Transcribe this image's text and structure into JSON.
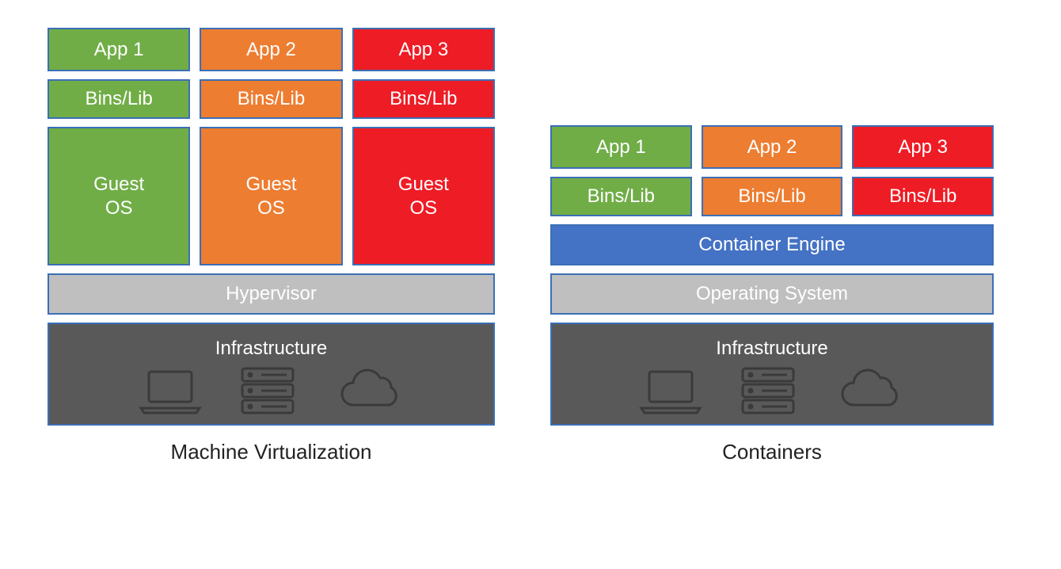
{
  "colors": {
    "green": "#70ad47",
    "orange": "#ed7d31",
    "red": "#ee1c25",
    "blue": "#4472c4",
    "grey": "#bfbfbf",
    "dark": "#595959",
    "border": "#3b6fb6"
  },
  "vm": {
    "apps": [
      "App 1",
      "App 2",
      "App 3"
    ],
    "libs": [
      "Bins/Lib",
      "Bins/Lib",
      "Bins/Lib"
    ],
    "guests": [
      "Guest\nOS",
      "Guest\nOS",
      "Guest\nOS"
    ],
    "hypervisor": "Hypervisor",
    "infrastructure": "Infrastructure",
    "caption": "Machine Virtualization"
  },
  "ct": {
    "apps": [
      "App 1",
      "App 2",
      "App 3"
    ],
    "libs": [
      "Bins/Lib",
      "Bins/Lib",
      "Bins/Lib"
    ],
    "engine": "Container Engine",
    "os": "Operating System",
    "infrastructure": "Infrastructure",
    "caption": "Containers"
  },
  "icons": {
    "laptop": "laptop-icon",
    "server": "server-icon",
    "cloud": "cloud-icon"
  }
}
